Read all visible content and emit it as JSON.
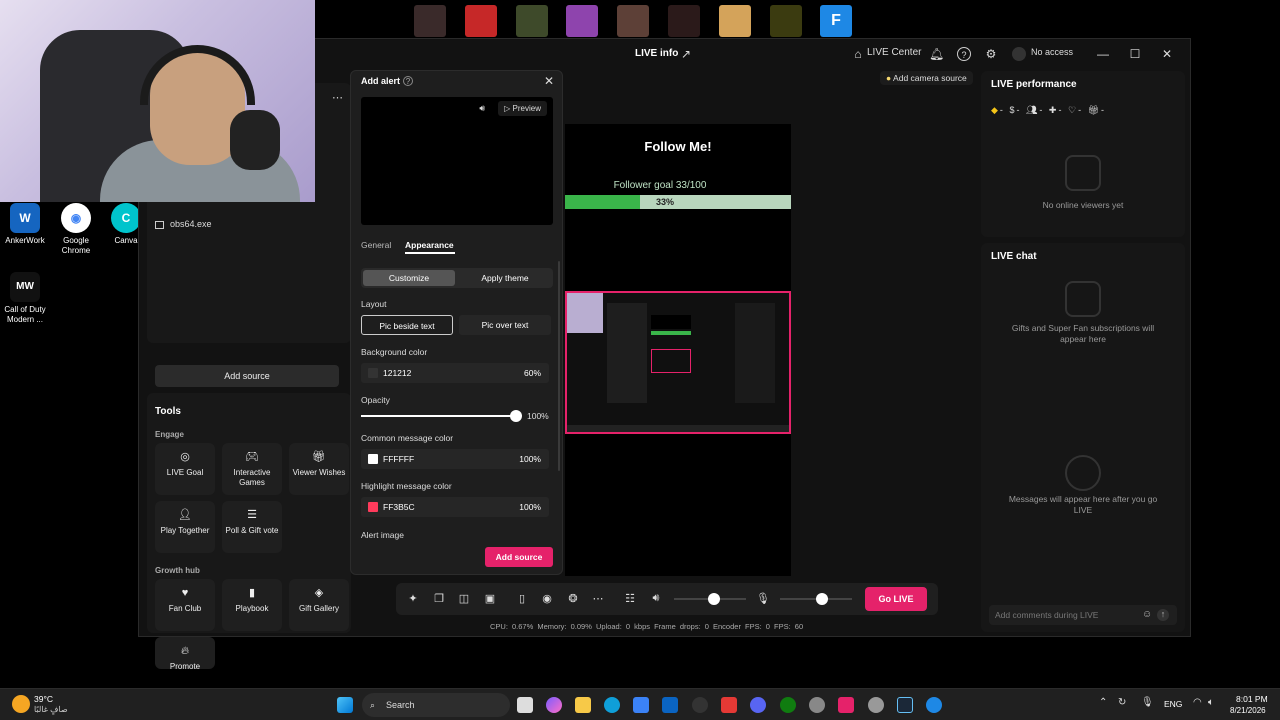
{
  "desktop": {
    "icons": [
      {
        "label": "AnkerWork",
        "color": "#1565c0",
        "glyph": "W"
      },
      {
        "label": "Google Chrome",
        "color": "#4285f4",
        "glyph": "◉"
      },
      {
        "label": "Canva",
        "color": "#00c4cc",
        "glyph": "C"
      },
      {
        "label": "Call of Duty Modern ...",
        "color": "#111111",
        "glyph": "MW"
      }
    ]
  },
  "titlebar": {
    "title": "LIVE info",
    "live_center": "LIVE Center",
    "no_access": "No access"
  },
  "left_panel": {
    "source_item": "obs64.exe",
    "add_source": "Add source",
    "tools_title": "Tools",
    "engage_title": "Engage",
    "engage_tools": [
      "LIVE Goal",
      "Interactive Games",
      "Viewer Wishes",
      "Play Together",
      "Poll & Gift vote"
    ],
    "growth_title": "Growth hub",
    "growth_tools": [
      "Fan Club",
      "Playbook",
      "Gift Gallery",
      "Promote"
    ]
  },
  "modal": {
    "title": "Add alert",
    "preview": "Preview",
    "tabs": [
      "General",
      "Appearance"
    ],
    "segments": [
      "Customize",
      "Apply theme"
    ],
    "layout_label": "Layout",
    "layout_options": [
      "Pic beside text",
      "Pic over text"
    ],
    "bg_label": "Background color",
    "bg_value": "121212",
    "bg_pct": "60%",
    "opacity_label": "Opacity",
    "opacity_value": "100%",
    "opacity_level": 1.0,
    "common_label": "Common message color",
    "common_value": "FFFFFF",
    "common_pct": "100%",
    "highlight_label": "Highlight message color",
    "highlight_value": "FF3B5C",
    "highlight_pct": "100%",
    "alert_image_label": "Alert image",
    "add_source_btn": "Add source",
    "colors": {
      "common": "#FFFFFF",
      "highlight": "#FF3B5C"
    }
  },
  "scene": {
    "follow": "Follow Me!",
    "goal_text": "Follower goal  33/100",
    "goal_pct": "33%",
    "goal_fraction": 0.33,
    "camera_source": "Add camera source"
  },
  "live_performance": {
    "title": "LIVE performance",
    "stats": [
      "-",
      "-",
      "-",
      "-",
      "-",
      "-"
    ],
    "empty": "No online viewers yet"
  },
  "live_chat": {
    "title": "LIVE chat",
    "gifts_msg": "Gifts and Super Fan subscriptions will appear here",
    "messages_msg": "Messages will appear here after you go LIVE",
    "comment_placeholder": "Add comments during LIVE"
  },
  "controls": {
    "go_live": "Go LIVE"
  },
  "stats_line": "CPU: 0.67%   Memory: 0.09%   Upload: 0 kbps   Frame drops: 0   Encoder FPS: 0   FPS: 60",
  "taskbar": {
    "weather_temp": "39°C",
    "weather_desc": "صافٍ غالبًا",
    "search": "Search",
    "lang": "ENG",
    "time": "8:01 PM",
    "date": "8/21/2026"
  },
  "accent": "#E5226A"
}
